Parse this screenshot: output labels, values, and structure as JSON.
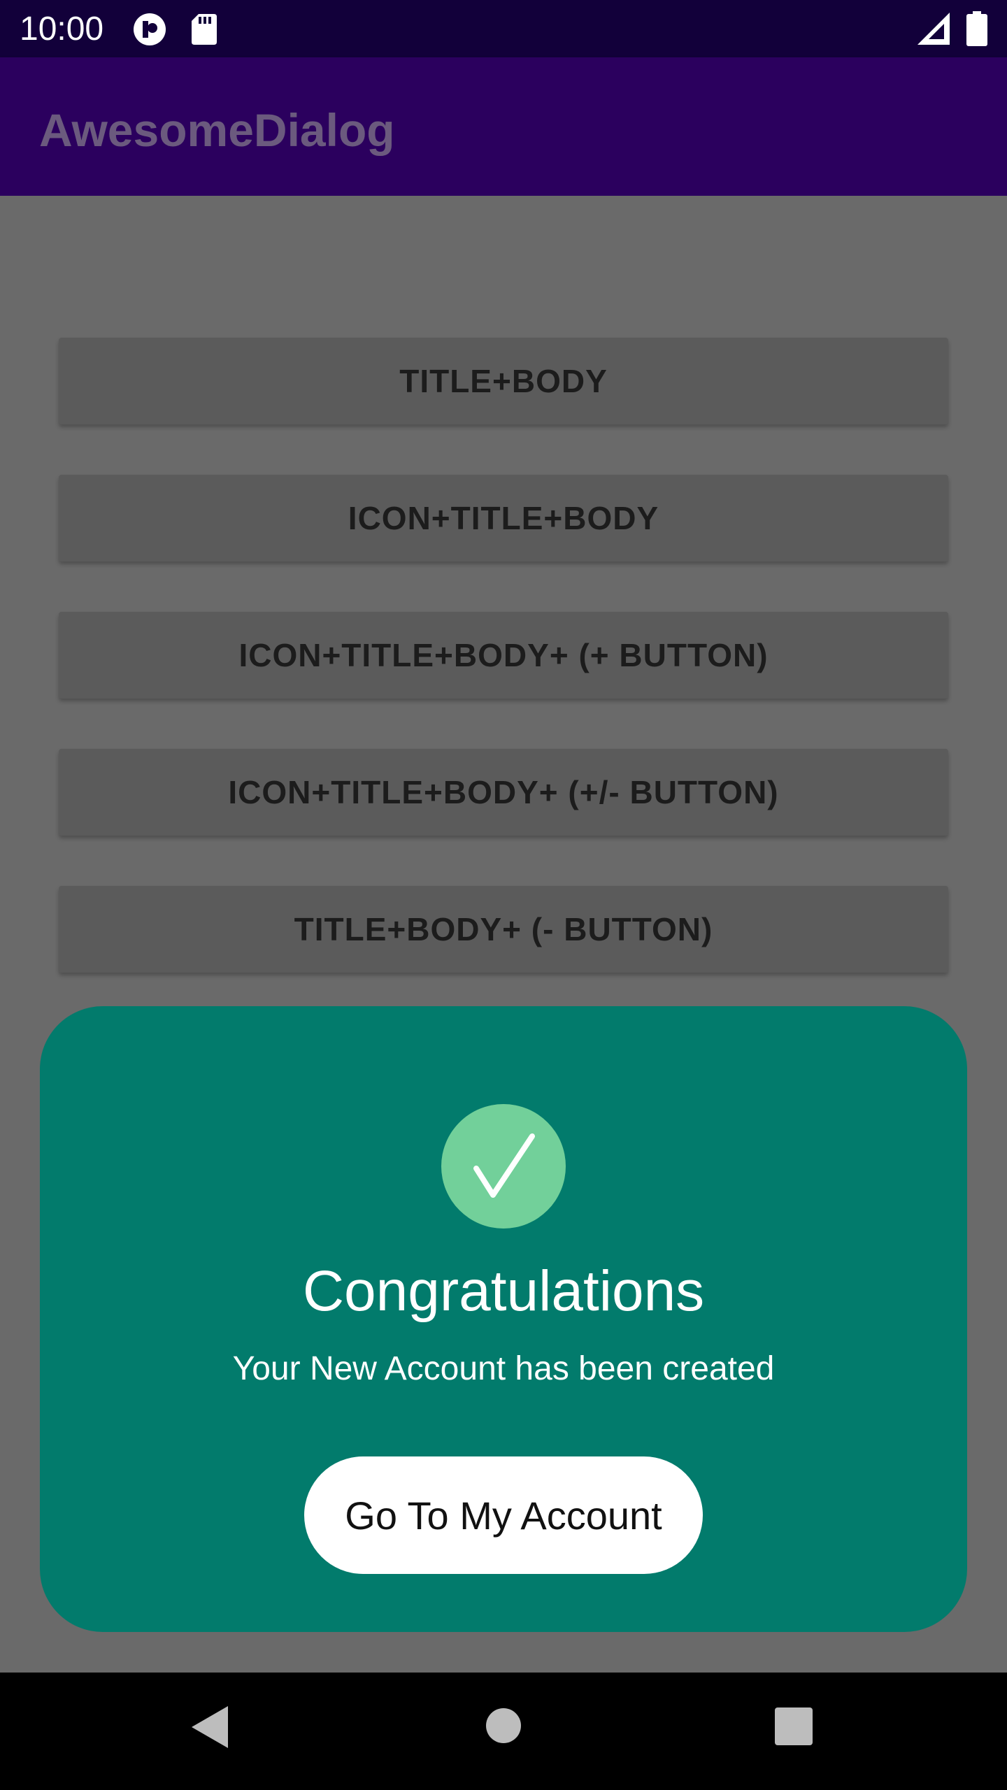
{
  "status_bar": {
    "time": "10:00",
    "icons": [
      "app-notification-icon",
      "sd-card-icon",
      "signal-icon",
      "battery-icon"
    ]
  },
  "app_bar": {
    "title": "AwesomeDialog"
  },
  "buttons": [
    {
      "label": "TITLE+BODY"
    },
    {
      "label": "ICON+TITLE+BODY"
    },
    {
      "label": "ICON+TITLE+BODY+ (+ BUTTON)"
    },
    {
      "label": "ICON+TITLE+BODY+ (+/- BUTTON)"
    },
    {
      "label": "TITLE+BODY+ (- BUTTON)"
    }
  ],
  "dialog": {
    "icon": "checkmark-icon",
    "title": "Congratulations",
    "body": "Your New Account has been created",
    "action_label": "Go To My Account"
  },
  "nav_bar": {
    "icons": [
      "back-icon",
      "home-icon",
      "recents-icon"
    ]
  },
  "colors": {
    "status_bar": "#12003a",
    "app_bar": "#2b005e",
    "scrim_background": "#6a6a6a",
    "button": "#5b5b5b",
    "dialog": "#027b6c",
    "check_circle": "#72d09a"
  }
}
